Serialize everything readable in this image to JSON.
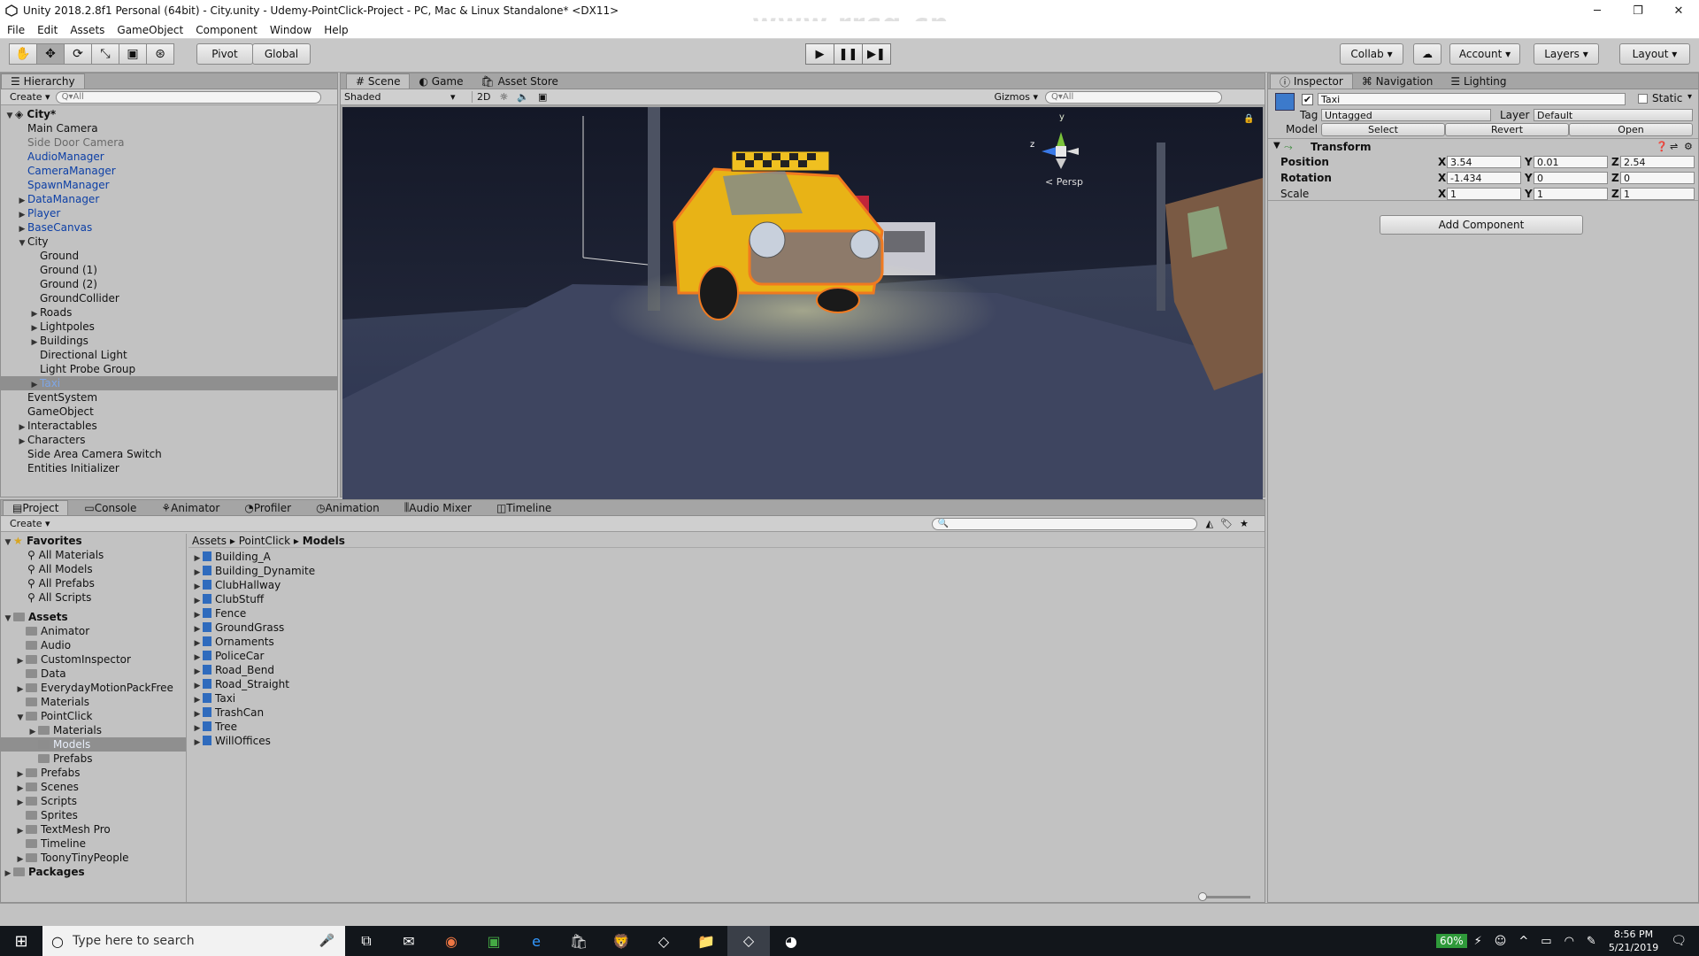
{
  "window": {
    "title": "Unity 2018.2.8f1 Personal (64bit) - City.unity - Udemy-PointClick-Project - PC, Mac & Linux Standalone* <DX11>",
    "watermark": "www.rrcg.cn"
  },
  "menu": [
    "File",
    "Edit",
    "Assets",
    "GameObject",
    "Component",
    "Window",
    "Help"
  ],
  "toolbar": {
    "pivot": "Pivot",
    "global": "Global",
    "collab": "Collab",
    "account": "Account",
    "layers": "Layers",
    "layout": "Layout"
  },
  "hierarchy": {
    "tab": "Hierarchy",
    "create": "Create",
    "search_placeholder": "Q▾All",
    "scene": "City*",
    "items": [
      {
        "label": "Main Camera",
        "indent": 1,
        "arrow": false,
        "style": "normal"
      },
      {
        "label": "Side Door Camera",
        "indent": 1,
        "arrow": false,
        "style": "grey"
      },
      {
        "label": "AudioManager",
        "indent": 1,
        "arrow": false,
        "style": "blue"
      },
      {
        "label": "CameraManager",
        "indent": 1,
        "arrow": false,
        "style": "blue"
      },
      {
        "label": "SpawnManager",
        "indent": 1,
        "arrow": false,
        "style": "blue"
      },
      {
        "label": "DataManager",
        "indent": 1,
        "arrow": "right",
        "style": "blue"
      },
      {
        "label": "Player",
        "indent": 1,
        "arrow": "right",
        "style": "blue"
      },
      {
        "label": "BaseCanvas",
        "indent": 1,
        "arrow": "right",
        "style": "blue"
      },
      {
        "label": "City",
        "indent": 1,
        "arrow": "down",
        "style": "normal"
      },
      {
        "label": "Ground",
        "indent": 2,
        "arrow": false,
        "style": "normal"
      },
      {
        "label": "Ground (1)",
        "indent": 2,
        "arrow": false,
        "style": "normal"
      },
      {
        "label": "Ground (2)",
        "indent": 2,
        "arrow": false,
        "style": "normal"
      },
      {
        "label": "GroundCollider",
        "indent": 2,
        "arrow": false,
        "style": "normal"
      },
      {
        "label": "Roads",
        "indent": 2,
        "arrow": "right",
        "style": "normal"
      },
      {
        "label": "Lightpoles",
        "indent": 2,
        "arrow": "right",
        "style": "normal"
      },
      {
        "label": "Buildings",
        "indent": 2,
        "arrow": "right",
        "style": "normal"
      },
      {
        "label": "Directional Light",
        "indent": 2,
        "arrow": false,
        "style": "normal"
      },
      {
        "label": "Light Probe Group",
        "indent": 2,
        "arrow": false,
        "style": "normal"
      },
      {
        "label": "Taxi",
        "indent": 2,
        "arrow": "right",
        "style": "sel"
      },
      {
        "label": "EventSystem",
        "indent": 1,
        "arrow": false,
        "style": "normal"
      },
      {
        "label": "GameObject",
        "indent": 1,
        "arrow": false,
        "style": "normal"
      },
      {
        "label": "Interactables",
        "indent": 1,
        "arrow": "right",
        "style": "normal"
      },
      {
        "label": "Characters",
        "indent": 1,
        "arrow": "right",
        "style": "normal"
      },
      {
        "label": "Side Area Camera Switch",
        "indent": 1,
        "arrow": false,
        "style": "normal"
      },
      {
        "label": "Entities Initializer",
        "indent": 1,
        "arrow": false,
        "style": "normal"
      }
    ]
  },
  "scene_view": {
    "tabs": [
      "Scene",
      "Game",
      "Asset Store"
    ],
    "shading": "Shaded",
    "mode_2d": "2D",
    "gizmos": "Gizmos",
    "search_placeholder": "Q▾All",
    "persp": "< Persp",
    "axis_y": "y",
    "axis_z": "z"
  },
  "inspector": {
    "tabs": [
      "Inspector",
      "Navigation",
      "Lighting"
    ],
    "object_name": "Taxi",
    "static_label": "Static",
    "tag_label": "Tag",
    "tag_value": "Untagged",
    "layer_label": "Layer",
    "layer_value": "Default",
    "model_label": "Model",
    "model_select": "Select",
    "model_revert": "Revert",
    "model_open": "Open",
    "transform_title": "Transform",
    "position_label": "Position",
    "rotation_label": "Rotation",
    "scale_label": "Scale",
    "position": {
      "x": "3.54",
      "y": "0.01",
      "z": "2.54"
    },
    "rotation": {
      "x": "-1.434",
      "y": "0",
      "z": "0"
    },
    "scale": {
      "x": "1",
      "y": "1",
      "z": "1"
    },
    "axis": {
      "x": "X",
      "y": "Y",
      "z": "Z"
    },
    "add_component": "Add Component"
  },
  "project": {
    "tabs": [
      "Project",
      "Console",
      "Animator",
      "Profiler",
      "Animation",
      "Audio Mixer",
      "Timeline"
    ],
    "create": "Create",
    "favorites_title": "Favorites",
    "favorites": [
      "All Materials",
      "All Models",
      "All Prefabs",
      "All Scripts"
    ],
    "assets_title": "Assets",
    "folders": [
      {
        "label": "Animator",
        "indent": 1,
        "arrow": false
      },
      {
        "label": "Audio",
        "indent": 1,
        "arrow": false
      },
      {
        "label": "CustomInspector",
        "indent": 1,
        "arrow": "right"
      },
      {
        "label": "Data",
        "indent": 1,
        "arrow": false
      },
      {
        "label": "EverydayMotionPackFree",
        "indent": 1,
        "arrow": "right"
      },
      {
        "label": "Materials",
        "indent": 1,
        "arrow": false
      },
      {
        "label": "PointClick",
        "indent": 1,
        "arrow": "down"
      },
      {
        "label": "Materials",
        "indent": 2,
        "arrow": "right"
      },
      {
        "label": "Models",
        "indent": 2,
        "arrow": false,
        "sel": true
      },
      {
        "label": "Prefabs",
        "indent": 2,
        "arrow": false
      },
      {
        "label": "Prefabs",
        "indent": 1,
        "arrow": "right"
      },
      {
        "label": "Scenes",
        "indent": 1,
        "arrow": "right"
      },
      {
        "label": "Scripts",
        "indent": 1,
        "arrow": "right"
      },
      {
        "label": "Sprites",
        "indent": 1,
        "arrow": false
      },
      {
        "label": "TextMesh Pro",
        "indent": 1,
        "arrow": "right"
      },
      {
        "label": "Timeline",
        "indent": 1,
        "arrow": false
      },
      {
        "label": "ToonyTinyPeople",
        "indent": 1,
        "arrow": "right"
      }
    ],
    "packages_title": "Packages",
    "breadcrumb": [
      "Assets",
      "PointClick",
      "Models"
    ],
    "models": [
      "Building_A",
      "Building_Dynamite",
      "ClubHallway",
      "ClubStuff",
      "Fence",
      "GroundGrass",
      "Ornaments",
      "PoliceCar",
      "Road_Bend",
      "Road_Straight",
      "Taxi",
      "TrashCan",
      "Tree",
      "WillOffices"
    ]
  },
  "taskbar": {
    "search_placeholder": "Type here to search",
    "battery": "60%",
    "time": "8:56 PM",
    "date": "5/21/2019"
  }
}
